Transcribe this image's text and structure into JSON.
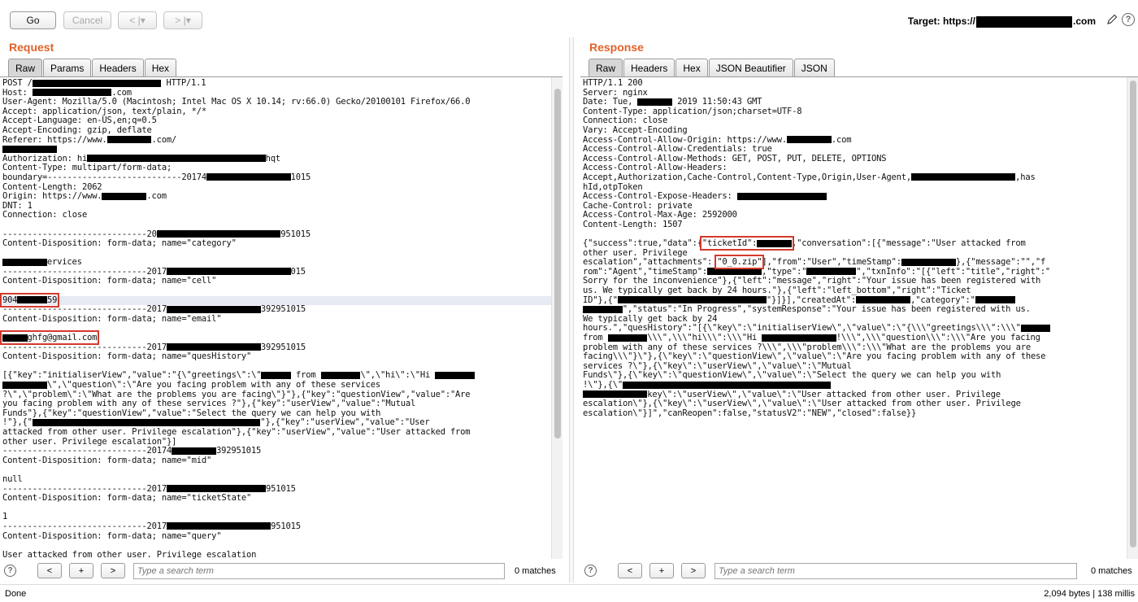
{
  "toolbar": {
    "go_label": "Go",
    "cancel_label": "Cancel",
    "back_label": "< |▾",
    "forward_label": "> |▾",
    "target_prefix": "Target: https://",
    "target_suffix": ".com"
  },
  "request": {
    "title": "Request",
    "tabs": [
      "Raw",
      "Params",
      "Headers",
      "Hex"
    ],
    "lines": [
      "POST /██████████████████████████ HTTP/1.1",
      "Host: ████████████████.com",
      "User-Agent: Mozilla/5.0 (Macintosh; Intel Mac OS X 10.14; rv:66.0) Gecko/20100101 Firefox/66.0",
      "Accept: application/json, text/plain, */*",
      "Accept-Language: en-US,en;q=0.5",
      "Accept-Encoding: gzip, deflate",
      "Referer: https://www.█████████.com/",
      "███████████",
      "Authorization: hi████████████████████████████████████hqt",
      "Content-Type: multipart/form-data;",
      "boundary=---------------------------20174█████████████████1015",
      "Content-Length: 2062",
      "Origin: https://www.█████████.com",
      "DNT: 1",
      "Connection: close",
      "",
      "-----------------------------20█████████████████████████951015",
      "Content-Disposition: form-data; name=\"category\"",
      "",
      "█████████ervices",
      "-----------------------------2017█████████████████████████015",
      "Content-Disposition: form-data; name=\"cell\"",
      "",
      "904██████59",
      "-----------------------------2017███████████████████392951015",
      "Content-Disposition: form-data; name=\"email\"",
      "",
      "█████ghfg@gmail.com",
      "-----------------------------2017███████████████████392951015",
      "Content-Disposition: form-data; name=\"quesHistory\"",
      "",
      "[{\"key\":\"initialiserView\",\"value\":\"{\\\"greetings\\\":\\\"██████ from ████████\\\",\\\"hi\\\":\\\"Hi ████████",
      "█████████\\\",\\\"question\\\":\\\"Are you facing problem with any of these services",
      "?\\\",\\\"problem\\\":\\\"What are the problems you are facing\\\"}\"},{\"key\":\"questionView\",\"value\":\"Are",
      "you facing problem with any of these services ?\"},{\"key\":\"userView\",\"value\":\"Mutual",
      "Funds\"},{\"key\":\"questionView\",\"value\":\"Select the query we can help you with",
      "!\"},{\"██████████████████████████████████████████████\"},{\"key\":\"userView\",\"value\":\"User",
      "attacked from other user. Privilege escalation\"},{\"key\":\"userView\",\"value\":\"User attacked from",
      "other user. Privilege escalation\"}]",
      "-----------------------------20174█████████392951015",
      "Content-Disposition: form-data; name=\"mid\"",
      "",
      "null",
      "-----------------------------2017████████████████████951015",
      "Content-Disposition: form-data; name=\"ticketState\"",
      "",
      "1",
      "-----------------------------2017█████████████████████951015",
      "Content-Disposition: form-data; name=\"query\"",
      "",
      "User attacked from other user. Privilege escalation"
    ],
    "search_placeholder": "Type a search term",
    "matches": "0 matches"
  },
  "response": {
    "title": "Response",
    "tabs": [
      "Raw",
      "Headers",
      "Hex",
      "JSON Beautifier",
      "JSON"
    ],
    "lines": [
      "HTTP/1.1 200",
      "Server: nginx",
      "Date: Tue, ███████ 2019 11:50:43 GMT",
      "Content-Type: application/json;charset=UTF-8",
      "Connection: close",
      "Vary: Accept-Encoding",
      "Access-Control-Allow-Origin: https://www.█████████.com",
      "Access-Control-Allow-Credentials: true",
      "Access-Control-Allow-Methods: GET, POST, PUT, DELETE, OPTIONS",
      "Access-Control-Allow-Headers:",
      "Accept,Authorization,Cache-Control,Content-Type,Origin,User-Agent,█████████████████████,has",
      "hId,otpToken",
      "Access-Control-Expose-Headers: ██████████████████",
      "Cache-Control: private",
      "Access-Control-Max-Age: 2592000",
      "Content-Length: 1507",
      "",
      "{\"success\":true,\"data\":{\"ticketId\":███████,\"conversation\":[{\"message\":\"User attacked from",
      "other user. Privilege",
      "escalation\",\"attachments\": \"0_0.zip\"],\"from\":\"User\",\"timeStamp\":███████████},{\"message\":\"\",\"f",
      "rom\":\"Agent\",\"timeStamp\":███████████,\"type\":\"██████████\",\"txnInfo\":\"[{\"left\":\"title\",\"right\":\"",
      "Sorry for the inconvenience\"},{\"left\":\"message\",\"right\":\"Your issue has been registered with",
      "us. We typically get back by 24 hours.\"},{\"left\":\"left_bottom\",\"right\":\"Ticket",
      "ID\"},{\"██████████████████████████████\"}]}],\"createdAt\":███████████,\"category\":\"████████",
      "████████\",\"status\":\"In Progress\",\"systemResponse\":\"Your issue has been registered with us.",
      "We typically get back by 24",
      "hours.\",\"quesHistory\":\"[{\\\"key\\\":\\\"initialiserView\\\",\\\"value\\\":\\\"{\\\\\\\"greetings\\\\\\\":\\\\\\\"██████",
      "from ████████\\\\\\\",\\\\\\\"hi\\\\\\\":\\\\\\\"Hi ███████████████!\\\\\\\",\\\\\\\"question\\\\\\\":\\\\\\\"Are you facing",
      "problem with any of these services ?\\\\\\\",\\\\\\\"problem\\\\\\\":\\\\\\\"What are the problems you are",
      "facing\\\\\\\"}\\\"},{\\\"key\\\":\\\"questionView\\\",\\\"value\\\":\\\"Are you facing problem with any of these",
      "services ?\\\"},{\\\"key\\\":\\\"userView\\\",\\\"value\\\":\\\"Mutual",
      "Funds\\\"},{\\\"key\\\":\\\"questionView\\\",\\\"value\\\":\\\"Select the query we can help you with",
      "!\\\"},{\\\"██████████████████████████████████████████",
      "█████████████key\\\":\\\"userView\\\",\\\"value\\\":\\\"User attacked from other user. Privilege",
      "escalation\\\"},{\\\"key\\\":\\\"userView\\\",\\\"value\\\":\\\"User attacked from other user. Privilege",
      "escalation\\\"}]\",\"canReopen\":false,\"statusV2\":\"NEW\",\"closed\":false}}"
    ],
    "search_placeholder": "Type a search term",
    "matches": "0 matches"
  },
  "status": {
    "left": "Done",
    "right": "2,094 bytes | 138 millis"
  },
  "colors": {
    "title_orange": "#e0632a",
    "highlight_box_red": "#d33a2c"
  }
}
